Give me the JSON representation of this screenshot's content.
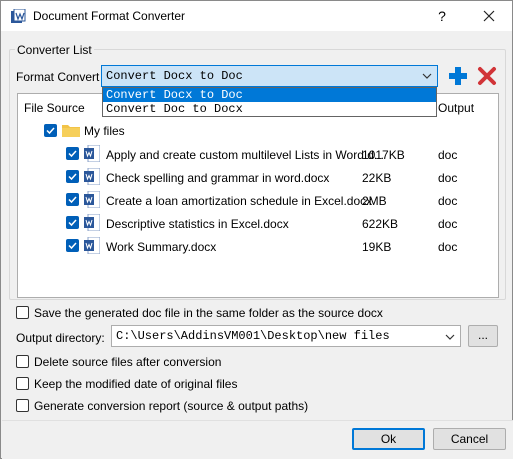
{
  "window": {
    "title": "Document Format Converter",
    "help_label": "?",
    "close_icon": "close-icon"
  },
  "converter": {
    "group_label": "Converter List",
    "format_label": "Format Convert",
    "selected": "Convert Docx to Doc",
    "options": [
      "Convert Docx to Doc",
      "Convert Doc to Docx"
    ],
    "add_icon": "plus-icon",
    "remove_icon": "x-icon"
  },
  "tree": {
    "headers": {
      "source": "File Source",
      "output": "Output"
    },
    "root": {
      "label": "My files",
      "checked": true
    },
    "files": [
      {
        "name": "Apply and create custom multilevel Lists in Word.d...",
        "size": "1017KB",
        "output": "doc",
        "checked": true
      },
      {
        "name": "Check spelling and grammar in word.docx",
        "size": "22KB",
        "output": "doc",
        "checked": true
      },
      {
        "name": "Create a loan amortization schedule in Excel.docx",
        "size": "2MB",
        "output": "doc",
        "checked": true
      },
      {
        "name": "Descriptive statistics in Excel.docx",
        "size": "622KB",
        "output": "doc",
        "checked": true
      },
      {
        "name": "Work Summary.docx",
        "size": "19KB",
        "output": "doc",
        "checked": true
      }
    ]
  },
  "options": {
    "same_folder": "Save the generated doc file in the same folder as the source docx",
    "output_dir_label": "Output directory:",
    "output_dir": "C:\\Users\\AddinsVM001\\Desktop\\new files",
    "browse": "...",
    "delete_source": "Delete source files after conversion",
    "keep_date": "Keep the modified date of original files",
    "report": "Generate conversion report (source & output paths)"
  },
  "buttons": {
    "ok": "Ok",
    "cancel": "Cancel"
  },
  "colors": {
    "accent": "#0078d7",
    "checkbox": "#005fb8",
    "folder": "#f2c347",
    "word": "#2b579a",
    "remove": "#d13438"
  }
}
